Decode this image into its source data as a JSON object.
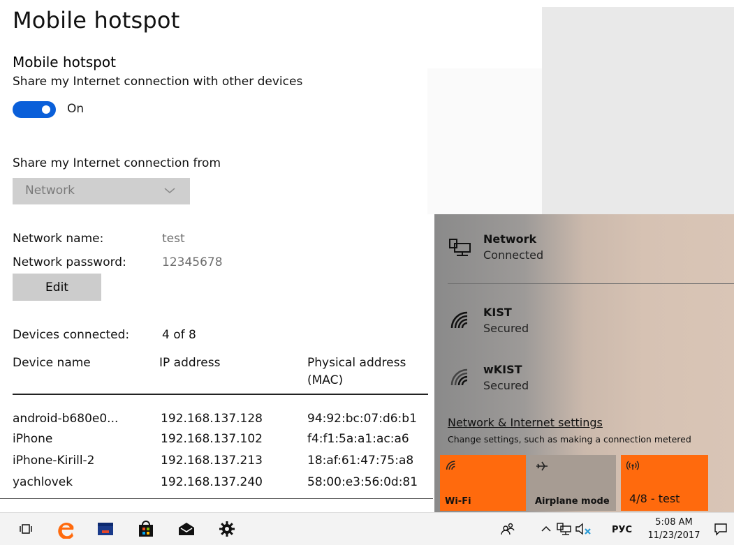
{
  "page": {
    "title": "Mobile hotspot",
    "section_title": "Mobile hotspot",
    "share_label": "Share my Internet connection with other devices",
    "toggle_state": "On",
    "share_from_label": "Share my Internet connection from",
    "share_from_value": "Network",
    "network_name_label": "Network name:",
    "network_name_value": "test",
    "network_password_label": "Network password:",
    "network_password_value": "12345678",
    "edit_label": "Edit",
    "devices_connected_label": "Devices connected:",
    "devices_connected_value": "4 of 8"
  },
  "table": {
    "headers": [
      "Device name",
      "IP address",
      "Physical address",
      "(MAC)"
    ],
    "rows": [
      [
        "android-b680e0...",
        "192.168.137.128",
        "94:92:bc:07:d6:b1"
      ],
      [
        "iPhone",
        "192.168.137.102",
        "f4:f1:5a:a1:ac:a6"
      ],
      [
        "iPhone-Kirill-2",
        "192.168.137.213",
        "18:af:61:47:75:a8"
      ],
      [
        "yachlovek",
        "192.168.137.240",
        "58:00:e3:56:0d:81"
      ]
    ]
  },
  "flyout": {
    "networks": [
      {
        "name": "Network",
        "status": "Connected",
        "icon": "ethernet-icon"
      },
      {
        "name": "KIST",
        "status": "Secured",
        "icon": "wifi-icon"
      },
      {
        "name": "wKIST",
        "status": "Secured",
        "icon": "wifi-icon"
      }
    ],
    "settings_link": "Network & Internet settings",
    "settings_sub": "Change settings, such as making a connection metered",
    "tiles": [
      {
        "label": "Wi-Fi",
        "icon": "wifi-icon",
        "active": true
      },
      {
        "label": "Airplane mode",
        "icon": "airplane-icon",
        "active": false
      },
      {
        "label": "4/8 - test",
        "icon": "hotspot-icon",
        "active": true
      }
    ],
    "colors": {
      "active_tile": "#ff6a0d",
      "inactive_tile": "#a79c93"
    }
  },
  "taskbar": {
    "icons": [
      "task-view-icon",
      "edge-icon",
      "file-explorer-icon",
      "store-icon",
      "mail-icon",
      "settings-icon"
    ],
    "tray": {
      "language": "РУС",
      "time": "5:08 AM",
      "date": "11/23/2017"
    }
  },
  "colors": {
    "accent": "#0a5fd9"
  }
}
